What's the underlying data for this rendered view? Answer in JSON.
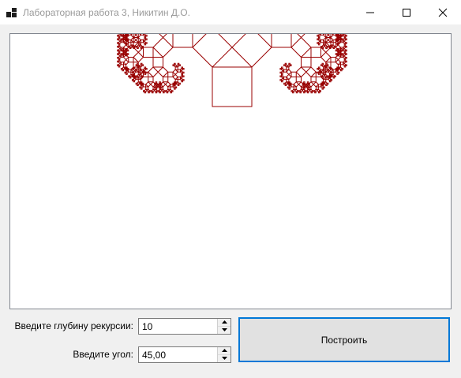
{
  "window": {
    "title": "Лабораторная работа 3, Никитин Д.О.",
    "icon": "app-window-icon",
    "controls": [
      "minimize-icon",
      "maximize-icon",
      "close-icon"
    ]
  },
  "canvas": {
    "fractal": "pythagoras-tree",
    "stroke_color": "#990000"
  },
  "form": {
    "depth_label": "Введите глубину рекурсии:",
    "depth_value": "10",
    "angle_label": "Введите угол:",
    "angle_value": "45,00",
    "build_button": "Построить"
  },
  "colors": {
    "accent": "#0078d7",
    "fractal": "#990000"
  }
}
